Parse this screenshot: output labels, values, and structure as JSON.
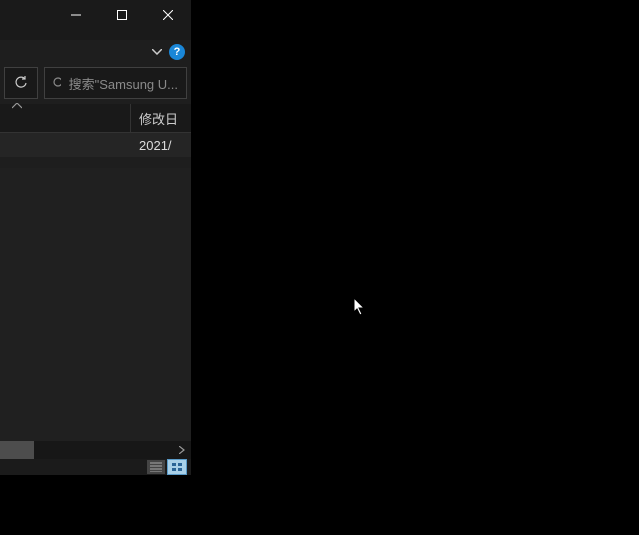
{
  "titlebar": {
    "minimize_icon": "minimize",
    "maximize_icon": "maximize",
    "close_icon": "close"
  },
  "help": {
    "chevron_icon": "chevron-down",
    "help_label": "?"
  },
  "toolbar": {
    "refresh_icon": "refresh",
    "search_placeholder": "搜索\"Samsung U..."
  },
  "columns": {
    "name_sort_icon": "chevron-up",
    "date_label": "修改日"
  },
  "rows": [
    {
      "date": "2021/"
    }
  ],
  "scrollbar": {
    "right_icon": "chevron-right"
  },
  "statusbar": {
    "details_icon": "details-view",
    "thumbs_icon": "thumbs-view"
  }
}
